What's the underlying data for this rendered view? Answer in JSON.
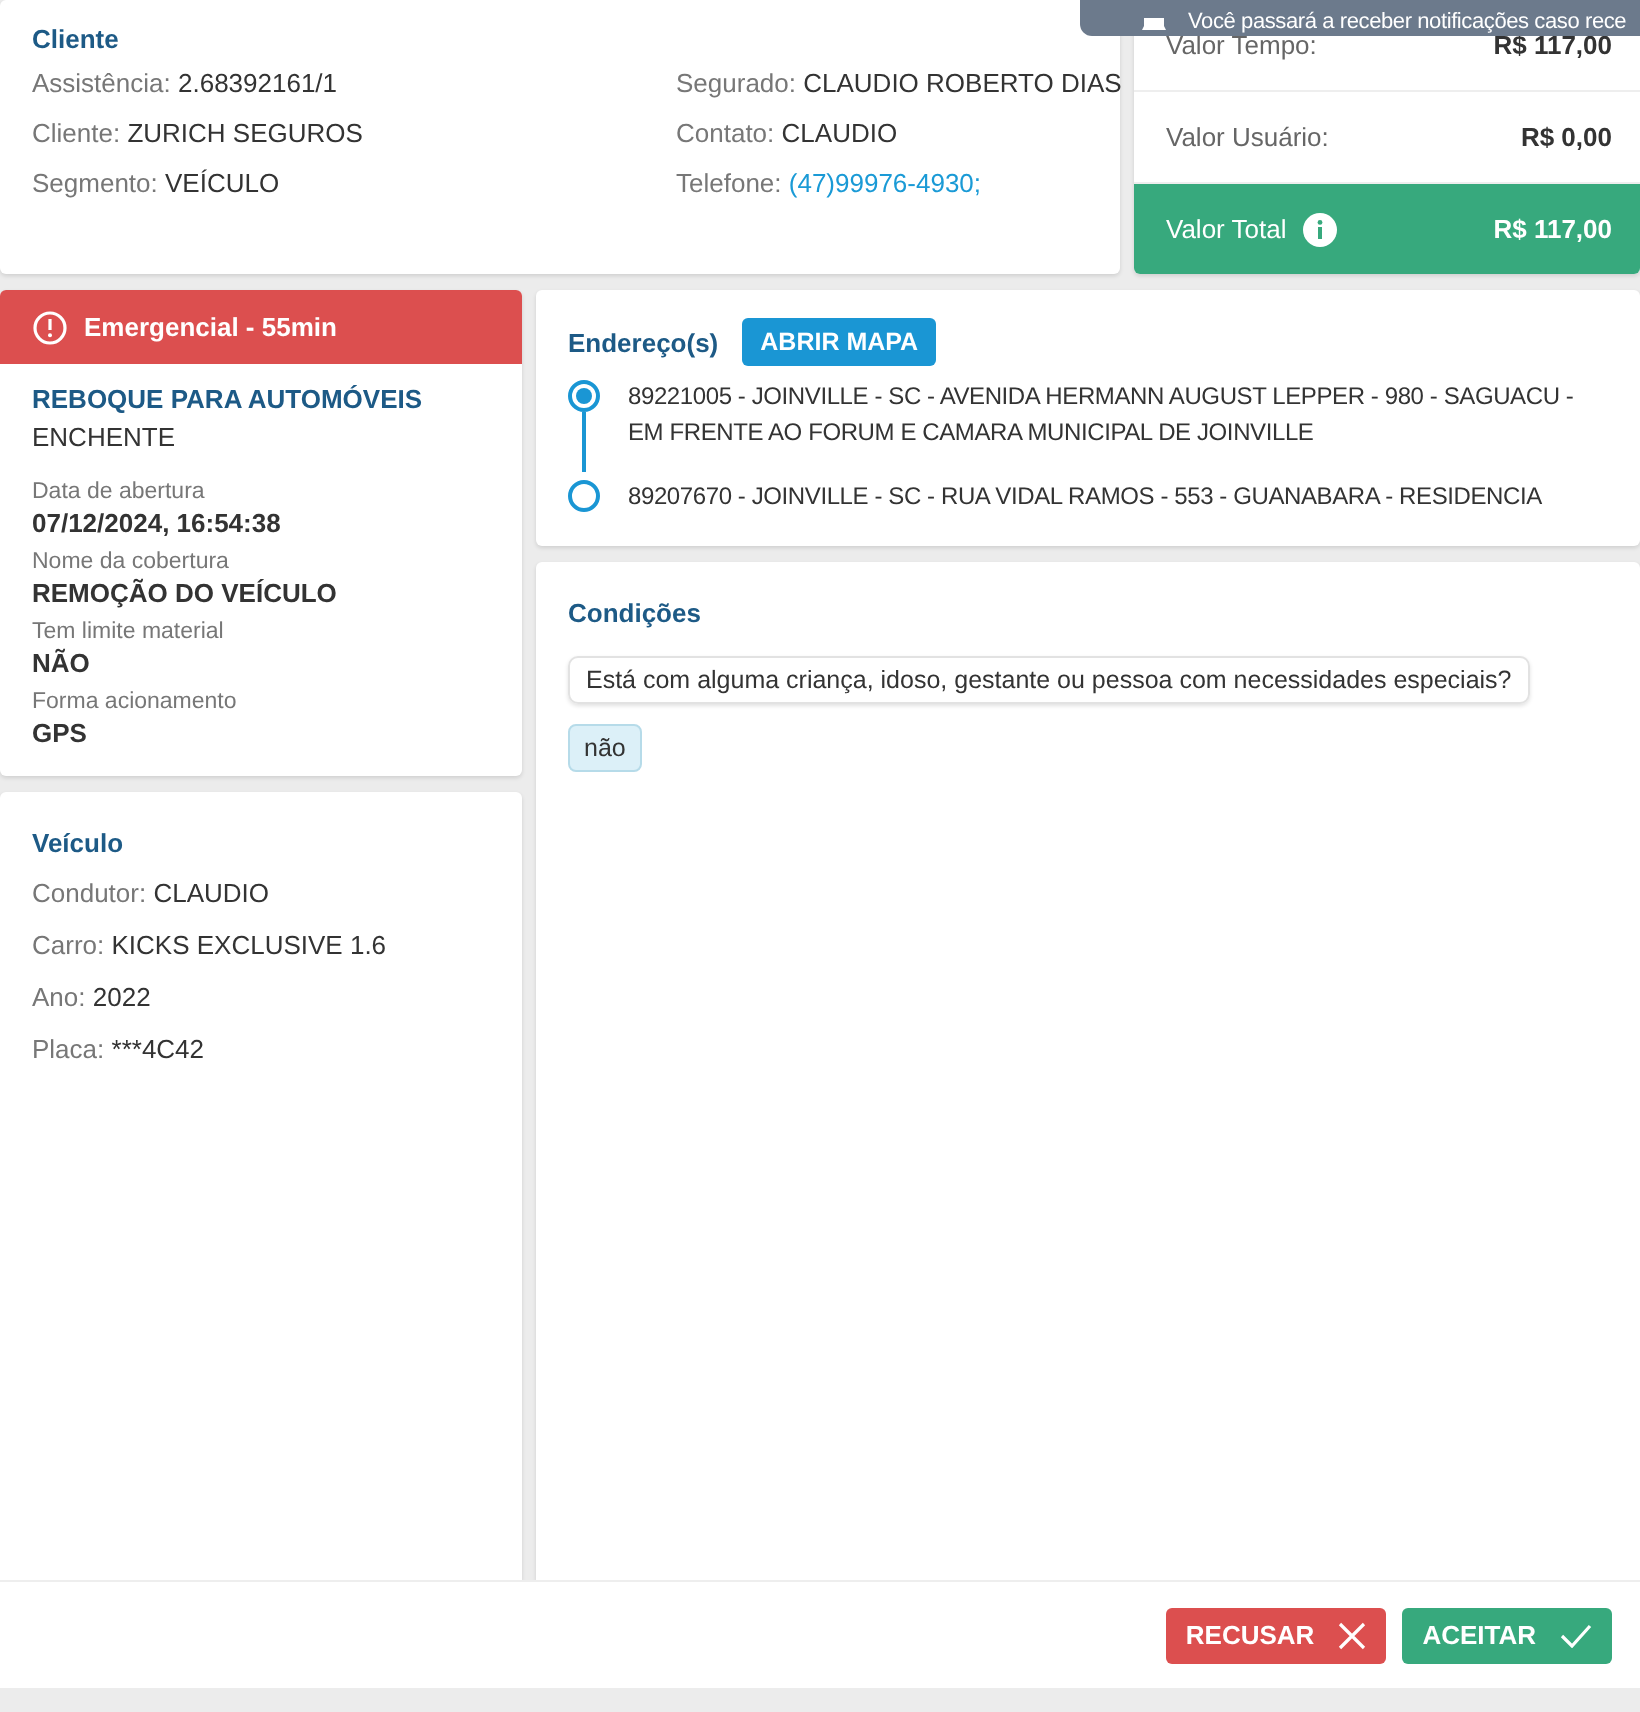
{
  "toast": {
    "text": "Você passará a receber notificações caso rece"
  },
  "cliente": {
    "title": "Cliente",
    "left": [
      {
        "label": "Assistência:",
        "value": "2.68392161/1",
        "kind": "text"
      },
      {
        "label": "Cliente:",
        "value": "ZURICH SEGUROS",
        "kind": "text"
      },
      {
        "label": "Segmento:",
        "value": "VEÍCULO",
        "kind": "text"
      }
    ],
    "right": [
      {
        "label": "Segurado:",
        "value": "CLAUDIO ROBERTO DIAS",
        "kind": "text"
      },
      {
        "label": "Contato:",
        "value": "CLAUDIO",
        "kind": "text"
      },
      {
        "label": "Telefone:",
        "value": "(47)99976-4930;",
        "kind": "link"
      }
    ]
  },
  "valores": [
    {
      "label": "Valor Tempo:",
      "value": "R$ 117,00",
      "kind": "plain"
    },
    {
      "label": "Valor Usuário:",
      "value": "R$ 0,00",
      "kind": "plain"
    },
    {
      "label": "Valor Total",
      "value": "R$ 117,00",
      "kind": "total"
    }
  ],
  "servico": {
    "priority": "Emergencial - 55min",
    "title": "REBOQUE PARA AUTOMÓVEIS",
    "subtitle": "ENCHENTE",
    "fields": [
      {
        "label": "Data de abertura",
        "value": "07/12/2024, 16:54:38"
      },
      {
        "label": "Nome da cobertura",
        "value": "REMOÇÃO DO VEÍCULO"
      },
      {
        "label": "Tem limite material",
        "value": "NÃO"
      },
      {
        "label": "Forma acionamento",
        "value": "GPS"
      }
    ]
  },
  "veiculo": {
    "title": "Veículo",
    "fields": [
      {
        "label": "Condutor:",
        "value": "CLAUDIO",
        "kind": "text"
      },
      {
        "label": "Carro:",
        "value": "KICKS EXCLUSIVE 1.6",
        "kind": "text"
      },
      {
        "label": "Ano:",
        "value": "2022",
        "kind": "text"
      },
      {
        "label": "Placa:",
        "value": "***4C42",
        "kind": "text"
      }
    ]
  },
  "enderecos": {
    "title": "Endereço(s)",
    "button": "ABRIR MAPA",
    "items": [
      {
        "text": "89221005 - JOINVILLE - SC - AVENIDA HERMANN AUGUST LEPPER - 980 - SAGUACU - EM FRENTE AO FORUM E CAMARA MUNICIPAL DE JOINVILLE",
        "selected": true
      },
      {
        "text": "89207670 - JOINVILLE - SC - RUA VIDAL RAMOS - 553 - GUANABARA - RESIDENCIA",
        "selected": false
      }
    ]
  },
  "condicoes": {
    "title": "Condições",
    "question": "Está com alguma criança, idoso, gestante ou pessoa com necessidades especiais?",
    "answer": "não"
  },
  "buttons": [
    {
      "label": "RECUSAR",
      "kind": "reject"
    },
    {
      "label": "ACEITAR",
      "kind": "accept"
    }
  ]
}
